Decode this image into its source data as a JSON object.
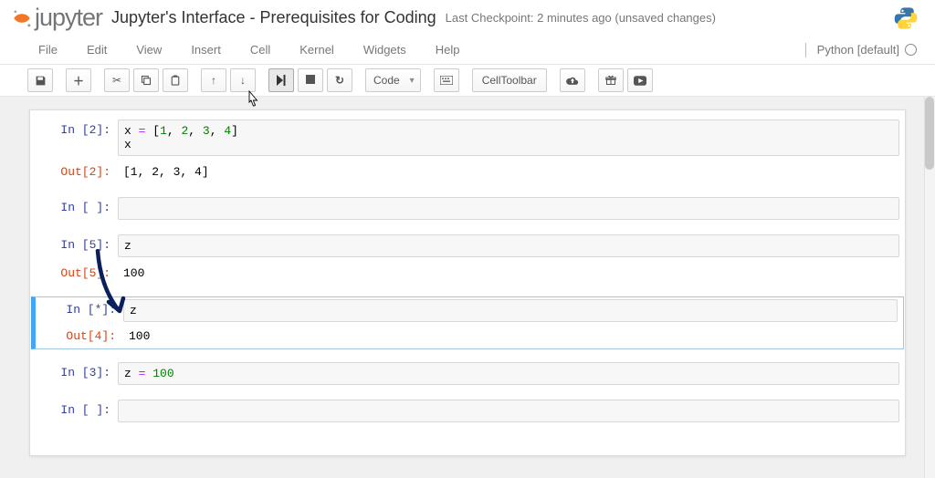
{
  "header": {
    "logo_text": "jupyter",
    "notebook_title": "Jupyter's Interface - Prerequisites for Coding",
    "checkpoint": "Last Checkpoint: 2 minutes ago (unsaved changes)"
  },
  "menu": {
    "items": [
      "File",
      "Edit",
      "View",
      "Insert",
      "Cell",
      "Kernel",
      "Widgets",
      "Help"
    ],
    "kernel_name": "Python [default]"
  },
  "toolbar": {
    "cell_type": "Code",
    "cell_toolbar_label": "CellToolbar",
    "icons": {
      "save": "save-icon",
      "add": "plus-icon",
      "cut": "scissors-icon",
      "copy": "copy-icon",
      "paste": "paste-icon",
      "up": "arrow-up-icon",
      "down": "arrow-down-icon",
      "run": "step-forward-icon",
      "stop": "stop-icon",
      "restart": "refresh-icon",
      "command": "keyboard-icon",
      "cloud": "cloud-upload-icon",
      "gift": "gift-icon",
      "youtube": "youtube-icon"
    }
  },
  "cells": [
    {
      "type": "code",
      "in_prompt": "In [2]:",
      "source_tokens": [
        [
          "var",
          "x"
        ],
        [
          "txt",
          " "
        ],
        [
          "op",
          "="
        ],
        [
          "txt",
          " "
        ],
        [
          "punct",
          "["
        ],
        [
          "num",
          "1"
        ],
        [
          "punct",
          ", "
        ],
        [
          "num",
          "2"
        ],
        [
          "punct",
          ", "
        ],
        [
          "num",
          "3"
        ],
        [
          "punct",
          ", "
        ],
        [
          "num",
          "4"
        ],
        [
          "punct",
          "]"
        ],
        [
          "nl",
          ""
        ],
        [
          "var",
          "x"
        ]
      ],
      "out_prompt": "Out[2]:",
      "output": "[1, 2, 3, 4]"
    },
    {
      "type": "code",
      "in_prompt": "In [ ]:",
      "source_tokens": [],
      "out_prompt": null,
      "output": null
    },
    {
      "type": "code",
      "in_prompt": "In [5]:",
      "source_tokens": [
        [
          "var",
          "z"
        ]
      ],
      "out_prompt": "Out[5]:",
      "output": "100"
    },
    {
      "type": "code",
      "selected": true,
      "in_prompt": "In [*]:",
      "source_tokens": [
        [
          "var",
          "z"
        ]
      ],
      "out_prompt": "Out[4]:",
      "output": "100"
    },
    {
      "type": "code",
      "in_prompt": "In [3]:",
      "source_tokens": [
        [
          "var",
          "z"
        ],
        [
          "txt",
          " "
        ],
        [
          "op",
          "="
        ],
        [
          "txt",
          " "
        ],
        [
          "num",
          "100"
        ]
      ],
      "out_prompt": null,
      "output": null
    },
    {
      "type": "code",
      "in_prompt": "In [ ]:",
      "source_tokens": [],
      "out_prompt": null,
      "output": null
    }
  ]
}
